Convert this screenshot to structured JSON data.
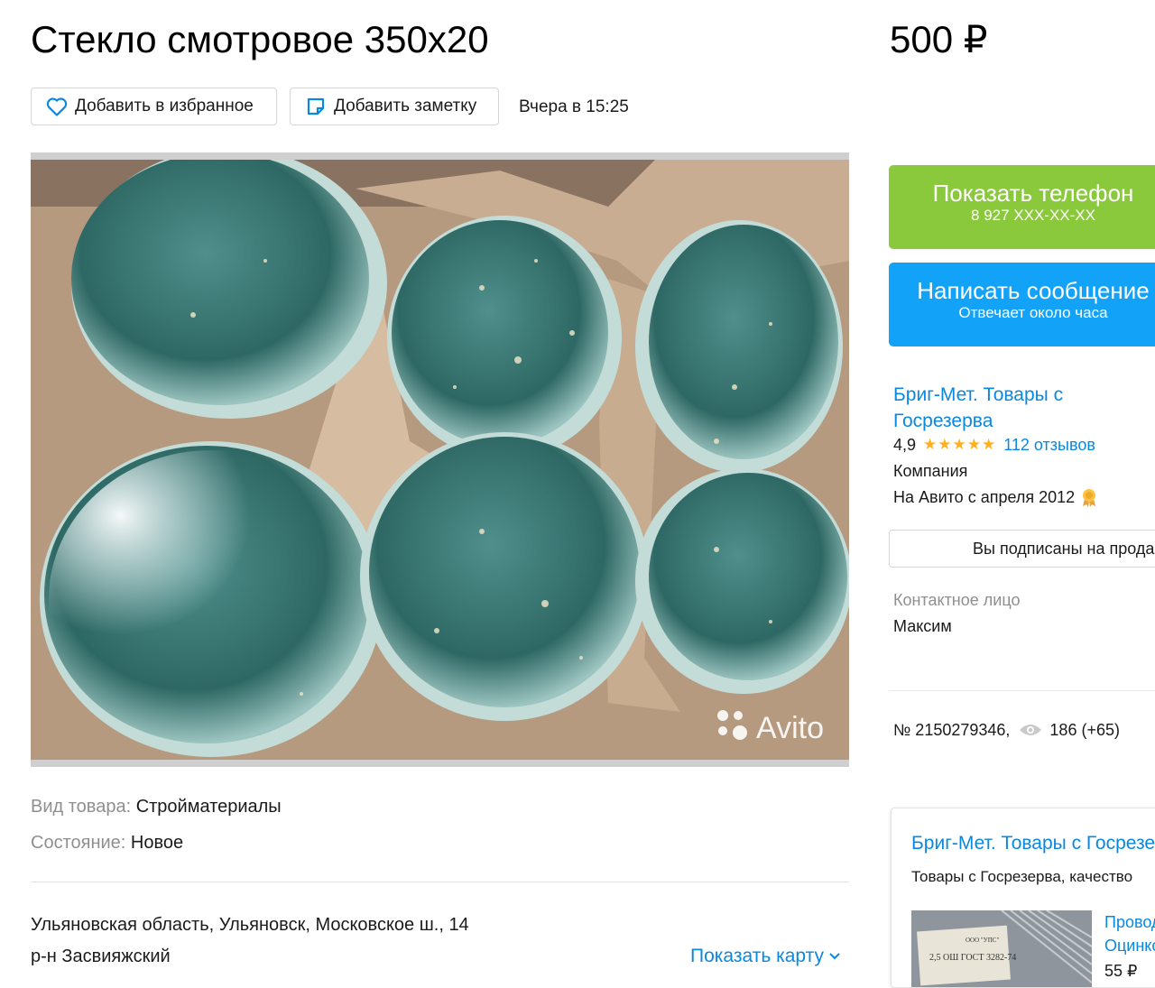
{
  "listing": {
    "title": "Стекло смотровое 350х20",
    "price": "500 ₽",
    "favorite_label": "Добавить в избранное",
    "note_label": "Добавить заметку",
    "date": "Вчера в 15:25",
    "photo_watermark": "Avito"
  },
  "params": [
    {
      "key": "Вид товара: ",
      "value": "Стройматериалы"
    },
    {
      "key": "Состояние: ",
      "value": "Новое"
    }
  ],
  "location": {
    "address": "Ульяновская область, Ульяновск, Московское ш., 14",
    "district": "р-н Засвияжский",
    "map_link": "Показать карту"
  },
  "sidebar": {
    "phone_button": {
      "label": "Показать телефон",
      "sub": "8 927 XXX-XX-XX"
    },
    "message_button": {
      "label": "Написать сообщение",
      "sub": "Отвечает около часа"
    },
    "seller": {
      "name": "Бриг-Мет. Товары с Госрезерва",
      "rating": "4,9",
      "stars": "★★★★★",
      "reviews": "112 отзывов",
      "type": "Компания",
      "since": "На Авито с апреля 2012"
    },
    "subscribed_label": "Вы подписаны на продавца",
    "contact_label": "Контактное лицо",
    "contact_name": "Максим",
    "ad_number": "№ 2150279346,",
    "views": "186 (+65)"
  },
  "shop_card": {
    "title": "Бриг-Мет. Товары с Госрезерва",
    "description": "Товары с Госрезерва, качество",
    "product_name_line1": "Провод",
    "product_name_line2": "Оцинкованный",
    "product_price": "55 ₽",
    "product_img_text1": "2,5  ОШ ГОСТ 3282-74",
    "product_img_text2": "ООО \"УПС\""
  },
  "colors": {
    "green_button": "#8ac83c",
    "blue_button": "#12a2f8",
    "link": "#0a88e0",
    "star": "#ffb021"
  }
}
